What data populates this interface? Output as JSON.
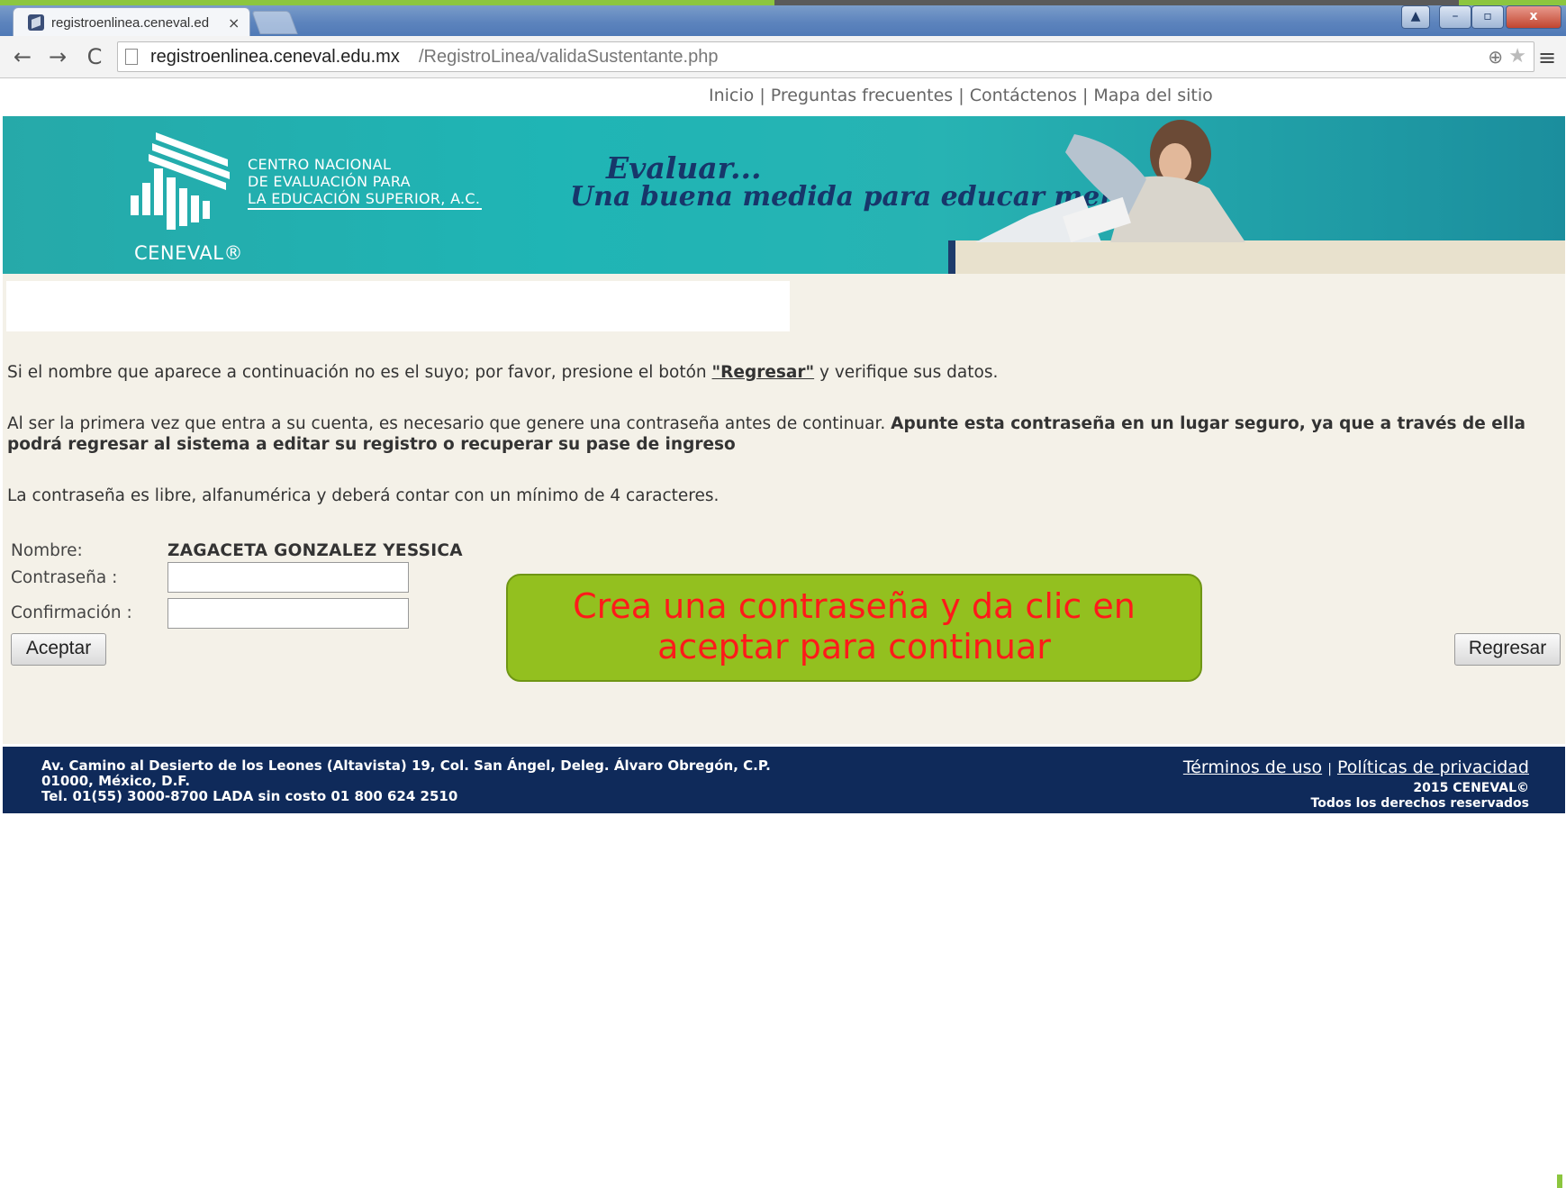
{
  "browser": {
    "tab_title": "registroenlinea.ceneval.ed",
    "tab_close": "×",
    "url_host": "registroenlinea.ceneval.edu.mx",
    "url_path": "/RegistroLinea/validaSustentante.php",
    "icons": {
      "back": "←",
      "forward": "→",
      "reload": "C",
      "zoom": "⊕",
      "star": "★",
      "menu": "≡",
      "user": "▲",
      "minimize": "–",
      "maximize": "▫",
      "close": "x"
    }
  },
  "topnav": {
    "items": [
      "Inicio",
      "Preguntas frecuentes",
      "Contáctenos",
      "Mapa del sitio"
    ],
    "separator": "|"
  },
  "banner": {
    "org_lines": [
      "CENTRO NACIONAL",
      "DE EVALUACIÓN PARA",
      "LA EDUCACIÓN SUPERIOR, A.C."
    ],
    "wordmark": "CENEVAL®",
    "slogan_1": "Evaluar...",
    "slogan_2": "Una buena medida para educar mejor"
  },
  "content": {
    "p1_before": "Si el nombre que aparece a continuación no es el suyo; por favor, presione el botón ",
    "p1_link": "\"Regresar\"",
    "p1_after": " y verifique sus datos.",
    "p2_normal": "Al ser la primera vez que entra a su cuenta, es necesario que genere una contraseña antes de continuar. ",
    "p2_bold": "Apunte esta contraseña en un lugar seguro, ya que a través de ella podrá regresar al sistema a editar su registro o recuperar su pase de ingreso",
    "p3": "La contraseña es libre, alfanumérica y deberá contar con un mínimo de 4 caracteres."
  },
  "form": {
    "nombre_label": "Nombre:",
    "nombre_value": "ZAGACETA GONZALEZ YESSICA",
    "password_label": "Contraseña :",
    "password_value": "",
    "confirm_label": "Confirmación :",
    "confirm_value": "",
    "accept_label": "Aceptar",
    "back_label": "Regresar"
  },
  "callout": {
    "text_line1": "Crea una contraseña y da clic en",
    "text_line2": "aceptar para continuar"
  },
  "footer": {
    "address_1": "Av. Camino al Desierto de los Leones (Altavista) 19, Col. San Ángel, Deleg. Álvaro Obregón, C.P.",
    "address_2": "01000, México, D.F.",
    "address_3": "Tel. 01(55) 3000-8700 LADA sin costo 01 800 624 2510",
    "terms": "Términos de uso",
    "link_sep": "|",
    "privacy": "Políticas de privacidad",
    "copyright": "2015 CENEVAL©",
    "rights": "Todos los derechos reservados"
  },
  "colors": {
    "banner_teal": "#1fb5b5",
    "slogan_navy": "#17366a",
    "footer_navy": "#0f2a5a",
    "callout_green": "#93c01f",
    "callout_text": "#ff1a1a",
    "content_bg": "#f4f1e8"
  }
}
